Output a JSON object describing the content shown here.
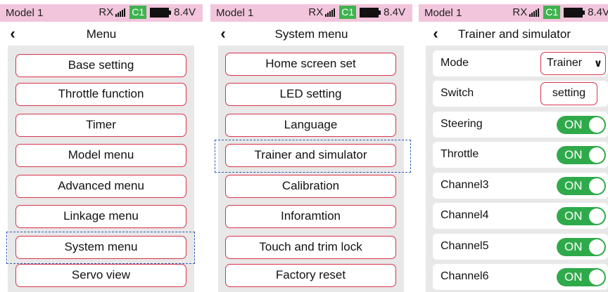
{
  "status": {
    "model": "Model 1",
    "rx": "RX",
    "channel": "C1",
    "voltage": "8.4V",
    "channel_color": "#3fb34f",
    "bar_color": "#f2c5dc"
  },
  "screen1": {
    "title": "Menu",
    "items": [
      "Base setting",
      "Throttle function",
      "Timer",
      "Model menu",
      "Advanced menu",
      "Linkage menu",
      "System menu",
      "Servo view"
    ],
    "selected_index": 6
  },
  "screen2": {
    "title": "System menu",
    "items": [
      "Home screen set",
      "LED setting",
      "Language",
      "Trainer and simulator",
      "Calibration",
      "Inforamtion",
      "Touch and trim lock",
      "Factory reset"
    ],
    "selected_index": 3
  },
  "screen3": {
    "title": "Trainer and simulator",
    "mode": {
      "label": "Mode",
      "value": "Trainer"
    },
    "switch": {
      "label": "Switch",
      "button": "setting"
    },
    "channels": [
      {
        "label": "Steering",
        "state": "ON"
      },
      {
        "label": "Throttle",
        "state": "ON"
      },
      {
        "label": "Channel3",
        "state": "ON"
      },
      {
        "label": "Channel4",
        "state": "ON"
      },
      {
        "label": "Channel5",
        "state": "ON"
      },
      {
        "label": "Channel6",
        "state": "ON"
      }
    ]
  },
  "colors": {
    "accent_border": "#d8334a",
    "toggle_on": "#2faa4a",
    "selection": "#2d5fb7"
  }
}
